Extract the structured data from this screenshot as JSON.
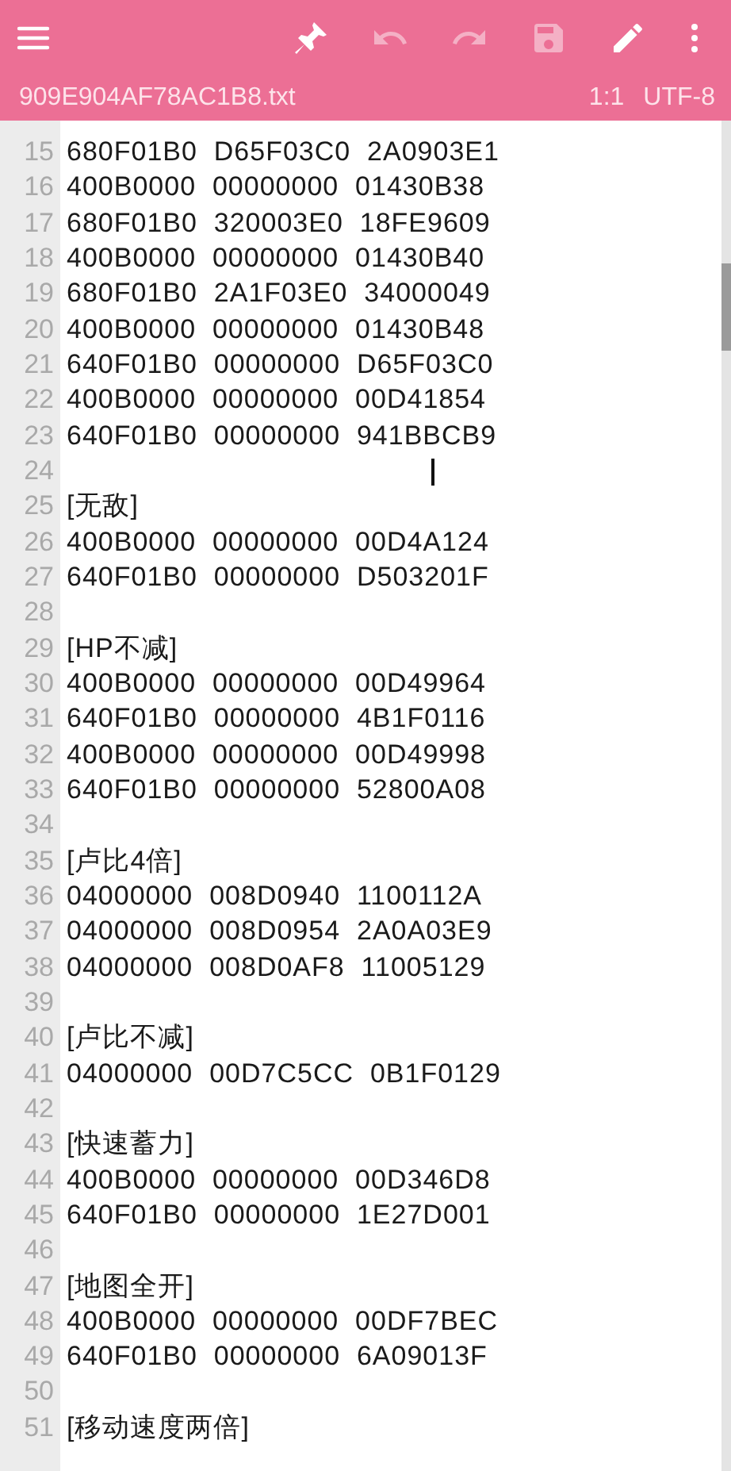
{
  "toolbar": {
    "buttons": [
      {
        "kind": "menu",
        "disabled": false
      },
      {
        "kind": "pin",
        "disabled": false
      },
      {
        "kind": "undo",
        "disabled": true
      },
      {
        "kind": "redo",
        "disabled": true
      },
      {
        "kind": "save",
        "disabled": true
      },
      {
        "kind": "edit",
        "disabled": false
      },
      {
        "kind": "more",
        "disabled": false
      }
    ]
  },
  "file_bar": {
    "filename": "909E904AF78AC1B8.txt",
    "position": "1:1",
    "encoding": "UTF-8"
  },
  "editor": {
    "lines": [
      {
        "number": "15",
        "text": "680F01B0  D65F03C0  2A0903E1",
        "cursor": false
      },
      {
        "number": "16",
        "text": "400B0000  00000000  01430B38",
        "cursor": false
      },
      {
        "number": "17",
        "text": "680F01B0  320003E0  18FE9609",
        "cursor": false
      },
      {
        "number": "18",
        "text": "400B0000  00000000  01430B40",
        "cursor": false
      },
      {
        "number": "19",
        "text": "680F01B0  2A1F03E0  34000049",
        "cursor": false
      },
      {
        "number": "20",
        "text": "400B0000  00000000  01430B48",
        "cursor": false
      },
      {
        "number": "21",
        "text": "640F01B0  00000000  D65F03C0",
        "cursor": false
      },
      {
        "number": "22",
        "text": "400B0000  00000000  00D41854",
        "cursor": false
      },
      {
        "number": "23",
        "text": "640F01B0  00000000  941BBCB9",
        "cursor": false
      },
      {
        "number": "24",
        "cursor": true
      },
      {
        "number": "25",
        "text": "[无敌]",
        "cursor": false
      },
      {
        "number": "26",
        "text": "400B0000  00000000  00D4A124",
        "cursor": false
      },
      {
        "number": "27",
        "text": "640F01B0  00000000  D503201F",
        "cursor": false
      },
      {
        "number": "28",
        "cursor": false
      },
      {
        "number": "29",
        "text": "[HP不减]",
        "cursor": false
      },
      {
        "number": "30",
        "text": "400B0000  00000000  00D49964",
        "cursor": false
      },
      {
        "number": "31",
        "text": "640F01B0  00000000  4B1F0116",
        "cursor": false
      },
      {
        "number": "32",
        "text": "400B0000  00000000  00D49998",
        "cursor": false
      },
      {
        "number": "33",
        "text": "640F01B0  00000000  52800A08",
        "cursor": false
      },
      {
        "number": "34",
        "cursor": false
      },
      {
        "number": "35",
        "text": "[卢比4倍]",
        "cursor": false
      },
      {
        "number": "36",
        "text": "04000000  008D0940  1100112A",
        "cursor": false
      },
      {
        "number": "37",
        "text": "04000000  008D0954  2A0A03E9",
        "cursor": false
      },
      {
        "number": "38",
        "text": "04000000  008D0AF8  11005129",
        "cursor": false
      },
      {
        "number": "39",
        "cursor": false
      },
      {
        "number": "40",
        "text": "[卢比不减]",
        "cursor": false
      },
      {
        "number": "41",
        "text": "04000000  00D7C5CC  0B1F0129",
        "cursor": false
      },
      {
        "number": "42",
        "cursor": false
      },
      {
        "number": "43",
        "text": "[快速蓄力]",
        "cursor": false
      },
      {
        "number": "44",
        "text": "400B0000  00000000  00D346D8",
        "cursor": false
      },
      {
        "number": "45",
        "text": "640F01B0  00000000  1E27D001",
        "cursor": false
      },
      {
        "number": "46",
        "cursor": false
      },
      {
        "number": "47",
        "text": "[地图全开]",
        "cursor": false
      },
      {
        "number": "48",
        "text": "400B0000  00000000  00DF7BEC",
        "cursor": false
      },
      {
        "number": "49",
        "text": "640F01B0  00000000  6A09013F",
        "cursor": false
      },
      {
        "number": "50",
        "cursor": false
      },
      {
        "number": "51",
        "text": "[移动速度两倍]",
        "cursor": false
      }
    ]
  }
}
